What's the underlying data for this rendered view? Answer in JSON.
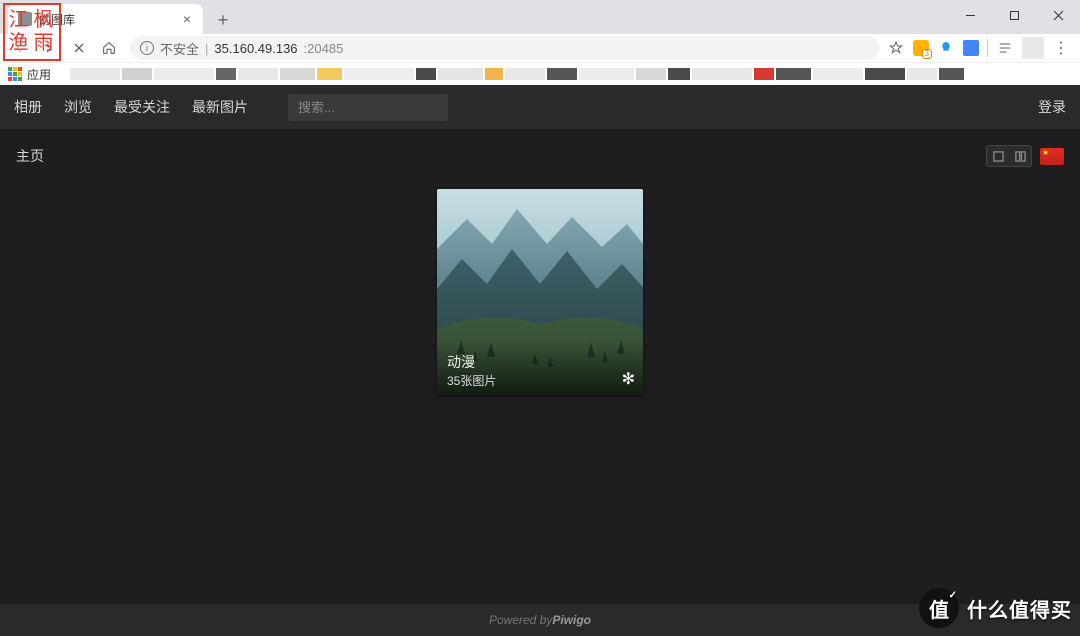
{
  "browser": {
    "tab_title": "的图库",
    "not_secure_label": "不安全",
    "url_host": "35.160.49.136",
    "url_port": ":20485",
    "apps_label": "应用"
  },
  "seal": {
    "c1": "江",
    "c2": "枫",
    "c3": "渔",
    "c4": "雨"
  },
  "nav": {
    "albums": "相册",
    "browse": "浏览",
    "popular": "最受关注",
    "latest": "最新图片",
    "search_placeholder": "搜索...",
    "login": "登录"
  },
  "page": {
    "breadcrumb": "主页"
  },
  "album": {
    "title": "动漫",
    "count": "35张图片"
  },
  "footer": {
    "prefix": "Powered by ",
    "brand": "Piwigo"
  },
  "watermark": {
    "badge": "值",
    "text": "什么值得买"
  }
}
